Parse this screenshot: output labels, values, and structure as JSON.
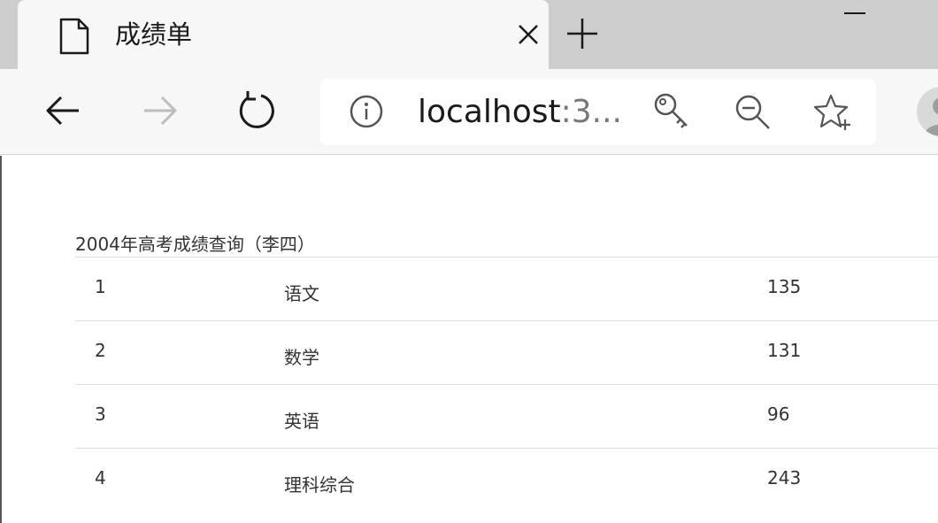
{
  "browser": {
    "tab": {
      "title": "成绩单"
    },
    "address_bar": {
      "url_host": "localhost",
      "url_rest": ":3..."
    }
  },
  "page": {
    "heading": "2004年高考成绩查询（李四）",
    "scores": [
      {
        "id": "1",
        "subject": "语文",
        "score": "135"
      },
      {
        "id": "2",
        "subject": "数学",
        "score": "131"
      },
      {
        "id": "3",
        "subject": "英语",
        "score": "96"
      },
      {
        "id": "4",
        "subject": "理科综合",
        "score": "243"
      }
    ]
  },
  "icons": {
    "tab": "document-icon",
    "close": "close-icon",
    "new_tab": "plus-icon",
    "minimize": "minimize-icon",
    "back": "back-arrow-icon",
    "forward": "forward-arrow-icon",
    "refresh": "refresh-icon",
    "info": "info-icon",
    "password": "key-icon",
    "zoom": "zoom-out-icon",
    "favorite": "star-plus-icon",
    "profile": "avatar"
  },
  "colors": {
    "tab_strip": "#cdcdcd",
    "toolbar": "#f7f7f7",
    "text": "#333333",
    "row_border": "#dddddd"
  }
}
